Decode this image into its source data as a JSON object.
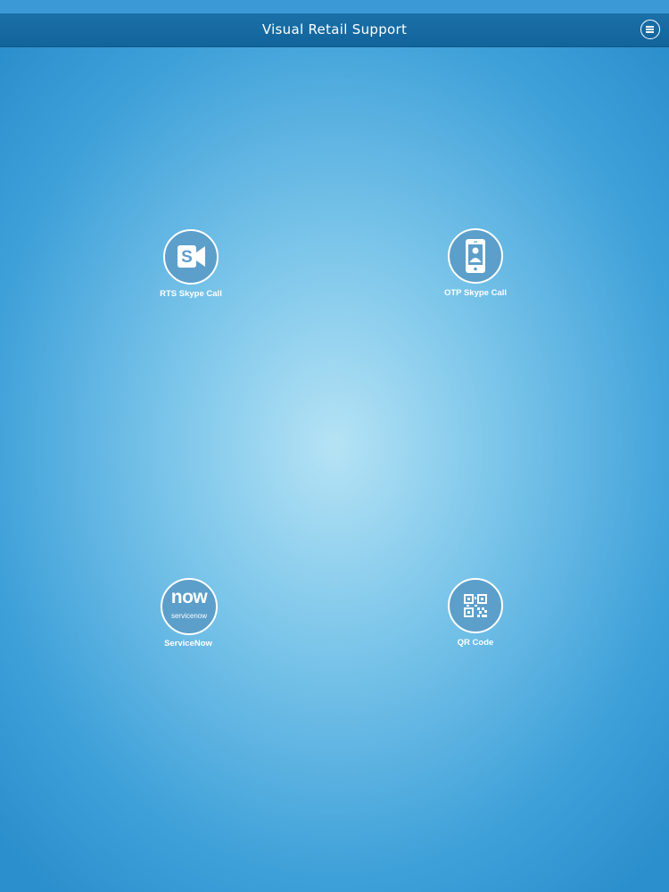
{
  "header": {
    "title": "Visual Retail Support",
    "menu_icon": "hamburger-menu-icon"
  },
  "tiles": [
    {
      "label": "RTS Skype Call",
      "icon": "skype-video-icon"
    },
    {
      "label": "OTP Skype Call",
      "icon": "phone-contact-icon"
    },
    {
      "label": "ServiceNow",
      "icon": "servicenow-logo",
      "logo_text": "now",
      "logo_subtext": "servicenow"
    },
    {
      "label": "QR Code",
      "icon": "qr-code-icon"
    }
  ],
  "colors": {
    "nav_bar": "#12649b",
    "background_center": "#b5e3f5",
    "background_edge": "#2c8fcd",
    "icon_fill": "#5c9fca"
  }
}
